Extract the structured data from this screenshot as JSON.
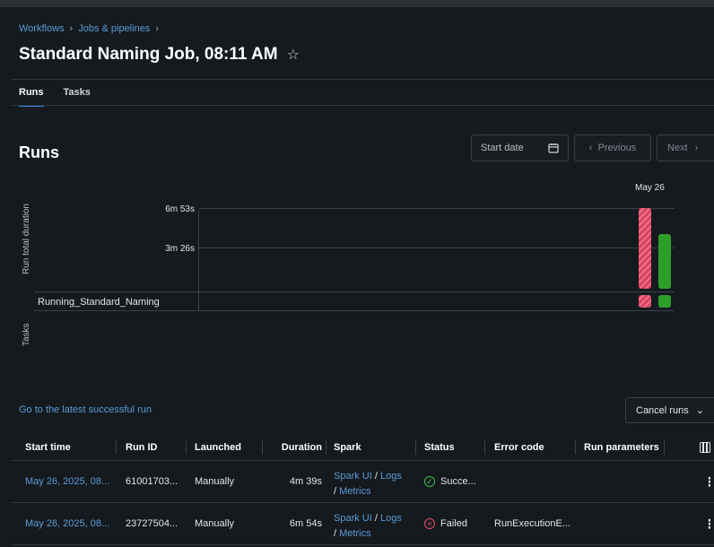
{
  "breadcrumb": [
    "Workflows",
    "Jobs & pipelines"
  ],
  "title": "Standard Naming Job, 08:11 AM",
  "tabs": [
    {
      "label": "Runs",
      "active": true
    },
    {
      "label": "Tasks",
      "active": false
    }
  ],
  "runs_section": {
    "heading": "Runs",
    "start_date_label": "Start date",
    "previous_label": "Previous",
    "next_label": "Next"
  },
  "chart": {
    "y_axis_label": "Run total duration",
    "tasks_axis_label": "Tasks",
    "ticks": [
      "6m 53s",
      "3m 26s"
    ],
    "date_label": "May 26",
    "task_name": "Running_Standard_Naming"
  },
  "chart_data": {
    "type": "bar",
    "categories": [
      "May 26",
      "May 26"
    ],
    "series": [
      {
        "status": "Failed",
        "duration_seconds": 414,
        "color": "#d6435f"
      },
      {
        "status": "Succeeded",
        "duration_seconds": 279,
        "color": "#2e9e2a"
      }
    ],
    "ylim": [
      0,
      413
    ]
  },
  "latest_link": "Go to the latest successful run",
  "cancel_runs_label": "Cancel runs",
  "table": {
    "headers": [
      "Start time",
      "Run ID",
      "Launched",
      "Duration",
      "Spark",
      "Status",
      "Error code",
      "Run parameters"
    ],
    "rows": [
      {
        "start_time": "May 26, 2025, 08...",
        "run_id": "61001703...",
        "launched": "Manually",
        "duration": "4m 39s",
        "spark_ui": "Spark UI",
        "spark_logs": "Logs",
        "spark_metrics": "Metrics",
        "status": "Succe...",
        "status_kind": "success",
        "error_code": ""
      },
      {
        "start_time": "May 26, 2025, 08...",
        "run_id": "23727504...",
        "launched": "Manually",
        "duration": "6m 54s",
        "spark_ui": "Spark UI",
        "spark_logs": "Logs",
        "spark_metrics": "Metrics",
        "status": "Failed",
        "status_kind": "failed",
        "error_code": "RunExecutionE..."
      }
    ]
  },
  "colors": {
    "accent": "#2b8df0",
    "link": "#5b9bd5",
    "success": "#3fbf4a",
    "failed": "#e0506a",
    "background": "#151a1f"
  }
}
